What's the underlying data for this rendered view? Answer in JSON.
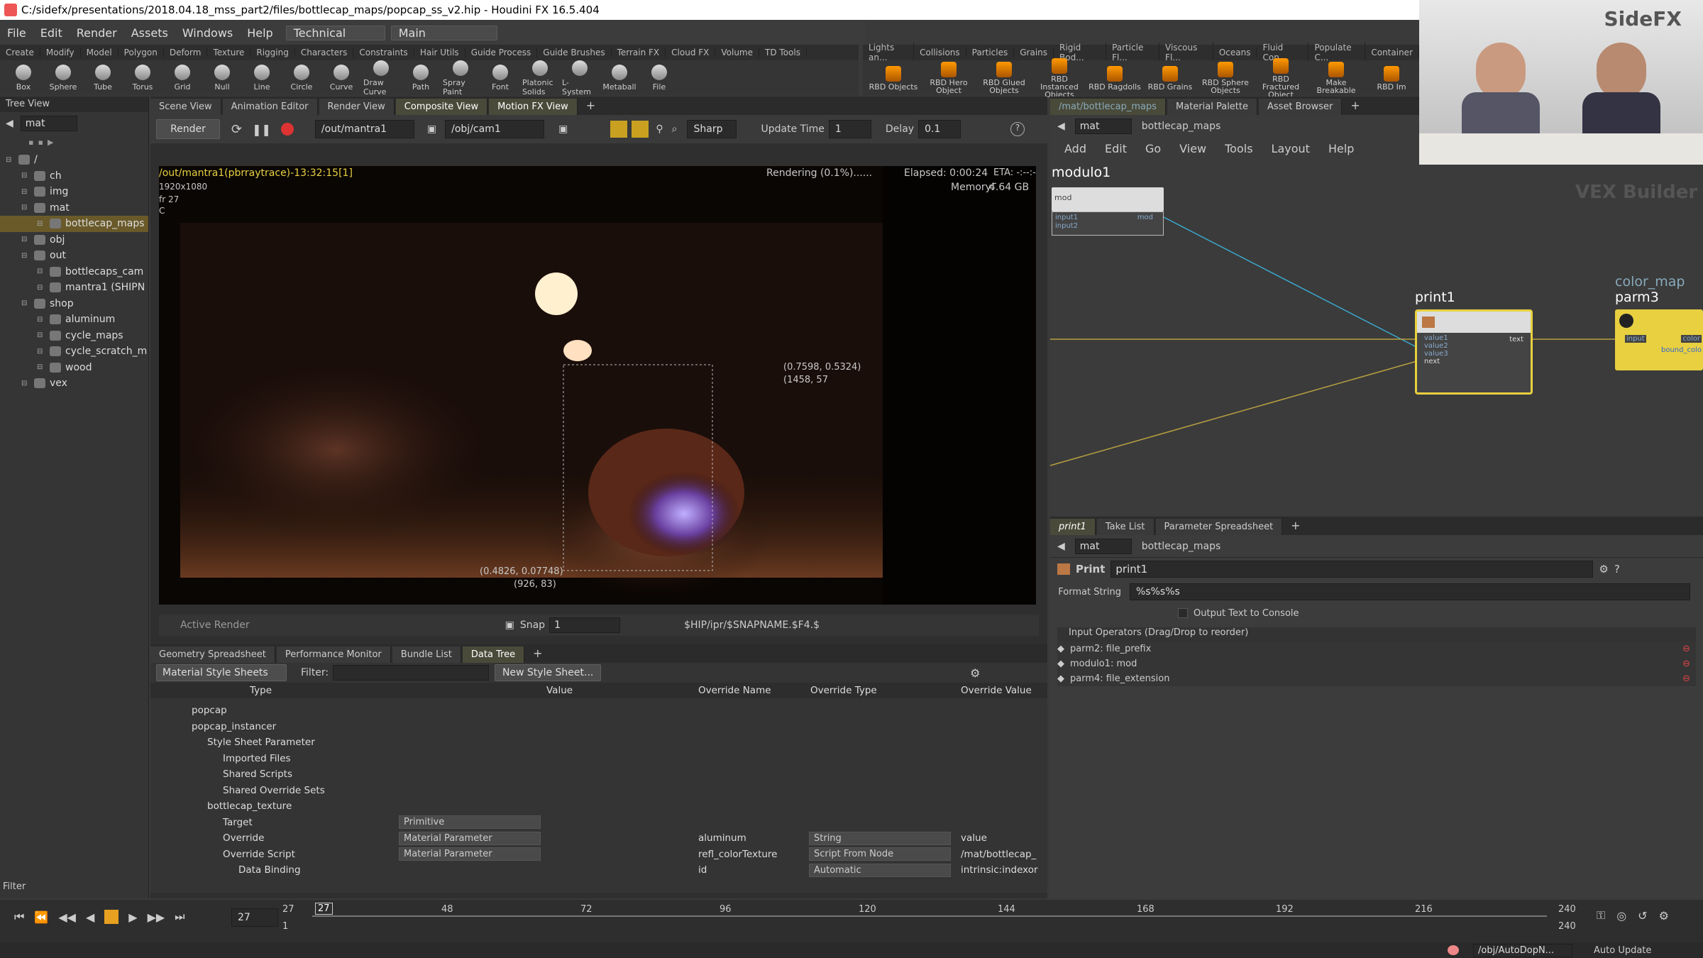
{
  "window": {
    "title": "C:/sidefx/presentations/2018.04.18_mss_part2/files/bottlecap_maps/popcap_ss_v2.hip - Houdini FX 16.5.404"
  },
  "menu": {
    "items": [
      "File",
      "Edit",
      "Render",
      "Assets",
      "Windows",
      "Help"
    ],
    "desktop": "Technical",
    "pane": "Main"
  },
  "shelf_tabs_left": [
    "Create",
    "Modify",
    "Model",
    "Polygon",
    "Deform",
    "Texture",
    "Rigging",
    "Characters",
    "Constraints",
    "Hair Utils",
    "Guide Process",
    "Guide Brushes",
    "Terrain FX",
    "Cloud FX",
    "Volume",
    "TD Tools"
  ],
  "shelf_tabs_right": [
    "Lights an...",
    "Collisions",
    "Particles",
    "Grains",
    "Rigid Bod...",
    "Particle Fl...",
    "Viscous Fl...",
    "Oceans",
    "Fluid Con...",
    "Populate C...",
    "Container"
  ],
  "tools_left": [
    "Box",
    "Sphere",
    "Tube",
    "Torus",
    "Grid",
    "Null",
    "Line",
    "Circle",
    "Curve",
    "Draw Curve",
    "Path",
    "Spray Paint",
    "Font",
    "Platonic Solids",
    "L-System",
    "Metaball",
    "File"
  ],
  "tools_right": [
    "RBD Objects",
    "RBD Hero Object",
    "RBD Glued Objects",
    "RBD Instanced Objects",
    "RBD Ragdolls",
    "RBD Grains",
    "RBD Sphere Objects",
    "RBD Fractured Object",
    "Make Breakable",
    "RBD Im"
  ],
  "tree": {
    "header": "Tree View",
    "path": "mat",
    "items": [
      {
        "label": "/",
        "depth": 0
      },
      {
        "label": "ch",
        "depth": 1
      },
      {
        "label": "img",
        "depth": 1
      },
      {
        "label": "mat",
        "depth": 1
      },
      {
        "label": "bottlecap_maps",
        "depth": 2
      },
      {
        "label": "obj",
        "depth": 1
      },
      {
        "label": "out",
        "depth": 1
      },
      {
        "label": "bottlecaps_cam",
        "depth": 2
      },
      {
        "label": "mantra1 (SHIPN",
        "depth": 2
      },
      {
        "label": "shop",
        "depth": 1
      },
      {
        "label": "aluminum",
        "depth": 2
      },
      {
        "label": "cycle_maps",
        "depth": 2
      },
      {
        "label": "cycle_scratch_m",
        "depth": 2
      },
      {
        "label": "wood",
        "depth": 2
      },
      {
        "label": "vex",
        "depth": 1
      }
    ],
    "filter": "Filter"
  },
  "view_tabs": [
    "Scene View",
    "Animation Editor",
    "Render View",
    "Composite View",
    "Motion FX View"
  ],
  "render_toolbar": {
    "render": "Render",
    "rop": "/out/mantra1",
    "camera": "/obj/cam1",
    "preview": "Sharp",
    "update_label": "Update Time",
    "update_value": "1",
    "delay_label": "Delay",
    "delay_value": "0.1"
  },
  "render_info": {
    "path": "/out/mantra1(pbrraytrace)-13:32:15[1]",
    "res": "1920x1080",
    "frame": "fr 27",
    "c": "C",
    "status": "Rendering (0.1%)......",
    "elapsed": "Elapsed: 0:00:24",
    "eta": "ETA: -:--:--",
    "memory_label": "Memory:",
    "memory": "4.64 GB",
    "coord1": "(0.7598, 0.5324)",
    "coord1b": "(1458, 57",
    "coord2": "(0.4826, 0.07748)",
    "coord2b": "(926, 83)"
  },
  "render_footer": {
    "active": "Active Render",
    "snap": "Snap",
    "snap_val": "1",
    "path": "$HIP/ipr/$SNAPNAME.$F4.$"
  },
  "ss_tabs": [
    "Geometry Spreadsheet",
    "Performance Monitor",
    "Bundle List",
    "Data Tree"
  ],
  "ss_toolbar": {
    "mode": "Material Style Sheets",
    "filter": "Filter:",
    "new": "New Style Sheet..."
  },
  "ss_headers": [
    "Type",
    "Value",
    "Override Name",
    "Override Type",
    "Override Value"
  ],
  "ss_rows": [
    {
      "label": "popcap",
      "indent": 1,
      "type": "",
      "name": "",
      "otype": "",
      "oval": ""
    },
    {
      "label": "popcap_instancer",
      "indent": 1,
      "type": "",
      "name": "",
      "otype": "",
      "oval": ""
    },
    {
      "label": "Style Sheet Parameter",
      "indent": 2,
      "type": "",
      "name": "",
      "otype": "",
      "oval": ""
    },
    {
      "label": "Imported Files",
      "indent": 3,
      "type": "",
      "name": "",
      "otype": "",
      "oval": ""
    },
    {
      "label": "Shared Scripts",
      "indent": 3,
      "type": "",
      "name": "",
      "otype": "",
      "oval": ""
    },
    {
      "label": "Shared Override Sets",
      "indent": 3,
      "type": "",
      "name": "",
      "otype": "",
      "oval": ""
    },
    {
      "label": "bottlecap_texture",
      "indent": 2,
      "type": "",
      "name": "",
      "otype": "",
      "oval": ""
    },
    {
      "label": "Target",
      "indent": 3,
      "type": "Primitive",
      "name": "",
      "otype": "",
      "oval": ""
    },
    {
      "label": "Override",
      "indent": 3,
      "type": "Material Parameter",
      "name": "aluminum",
      "otype": "String",
      "oval": "value"
    },
    {
      "label": "Override Script",
      "indent": 3,
      "type": "Material Parameter",
      "name": "refl_colorTexture",
      "otype": "Script From Node",
      "oval": "/mat/bottlecap_"
    },
    {
      "label": "Data Binding",
      "indent": 4,
      "type": "",
      "name": "id",
      "otype": "Automatic",
      "oval": "intrinsic:indexor"
    }
  ],
  "net": {
    "tabs": [
      "/mat/bottlecap_maps",
      "Material Palette",
      "Asset Browser"
    ],
    "path": [
      "mat",
      "bottlecap_maps"
    ],
    "menu": [
      "Add",
      "Edit",
      "Go",
      "View",
      "Tools",
      "Layout",
      "Help"
    ],
    "watermark": "VEX Builder",
    "nodes": {
      "modulo": "modulo1",
      "modulo_in": [
        "input1",
        "input2"
      ],
      "modulo_out": "mod",
      "modulo_label": "mod",
      "print": "print1",
      "print_in": [
        "value1",
        "value2",
        "value3",
        "next"
      ],
      "print_out": "text",
      "color_map": "color_map",
      "parm3": "parm3",
      "parm3_in": "input",
      "parm3_out": "color",
      "parm3_bound": "bound_colo"
    }
  },
  "parms": {
    "tabs": [
      "print1",
      "Take List",
      "Parameter Spreadsheet"
    ],
    "path": [
      "mat",
      "bottlecap_maps"
    ],
    "type": "Print",
    "name": "print1",
    "format_label": "Format String",
    "format_value": "%s%s%s",
    "console": "Output Text to Console",
    "inputs_header": "Input Operators (Drag/Drop to reorder)",
    "inputs": [
      "parm2: file_prefix",
      "modulo1: mod",
      "parm4: file_extension"
    ]
  },
  "timeline": {
    "frame": "27",
    "start": "1",
    "current_marker": "27",
    "ticks": [
      "48",
      "72",
      "96",
      "120",
      "144",
      "168",
      "192",
      "216"
    ],
    "end": "240",
    "end2": "240"
  },
  "status": {
    "path": "/obj/AutoDopN...",
    "update": "Auto Update"
  },
  "webcam": {
    "logo": "SideFX"
  },
  "colors": {
    "accent": "#e8d040",
    "select": "#6a5a2a",
    "wire": "#3aaad0"
  }
}
